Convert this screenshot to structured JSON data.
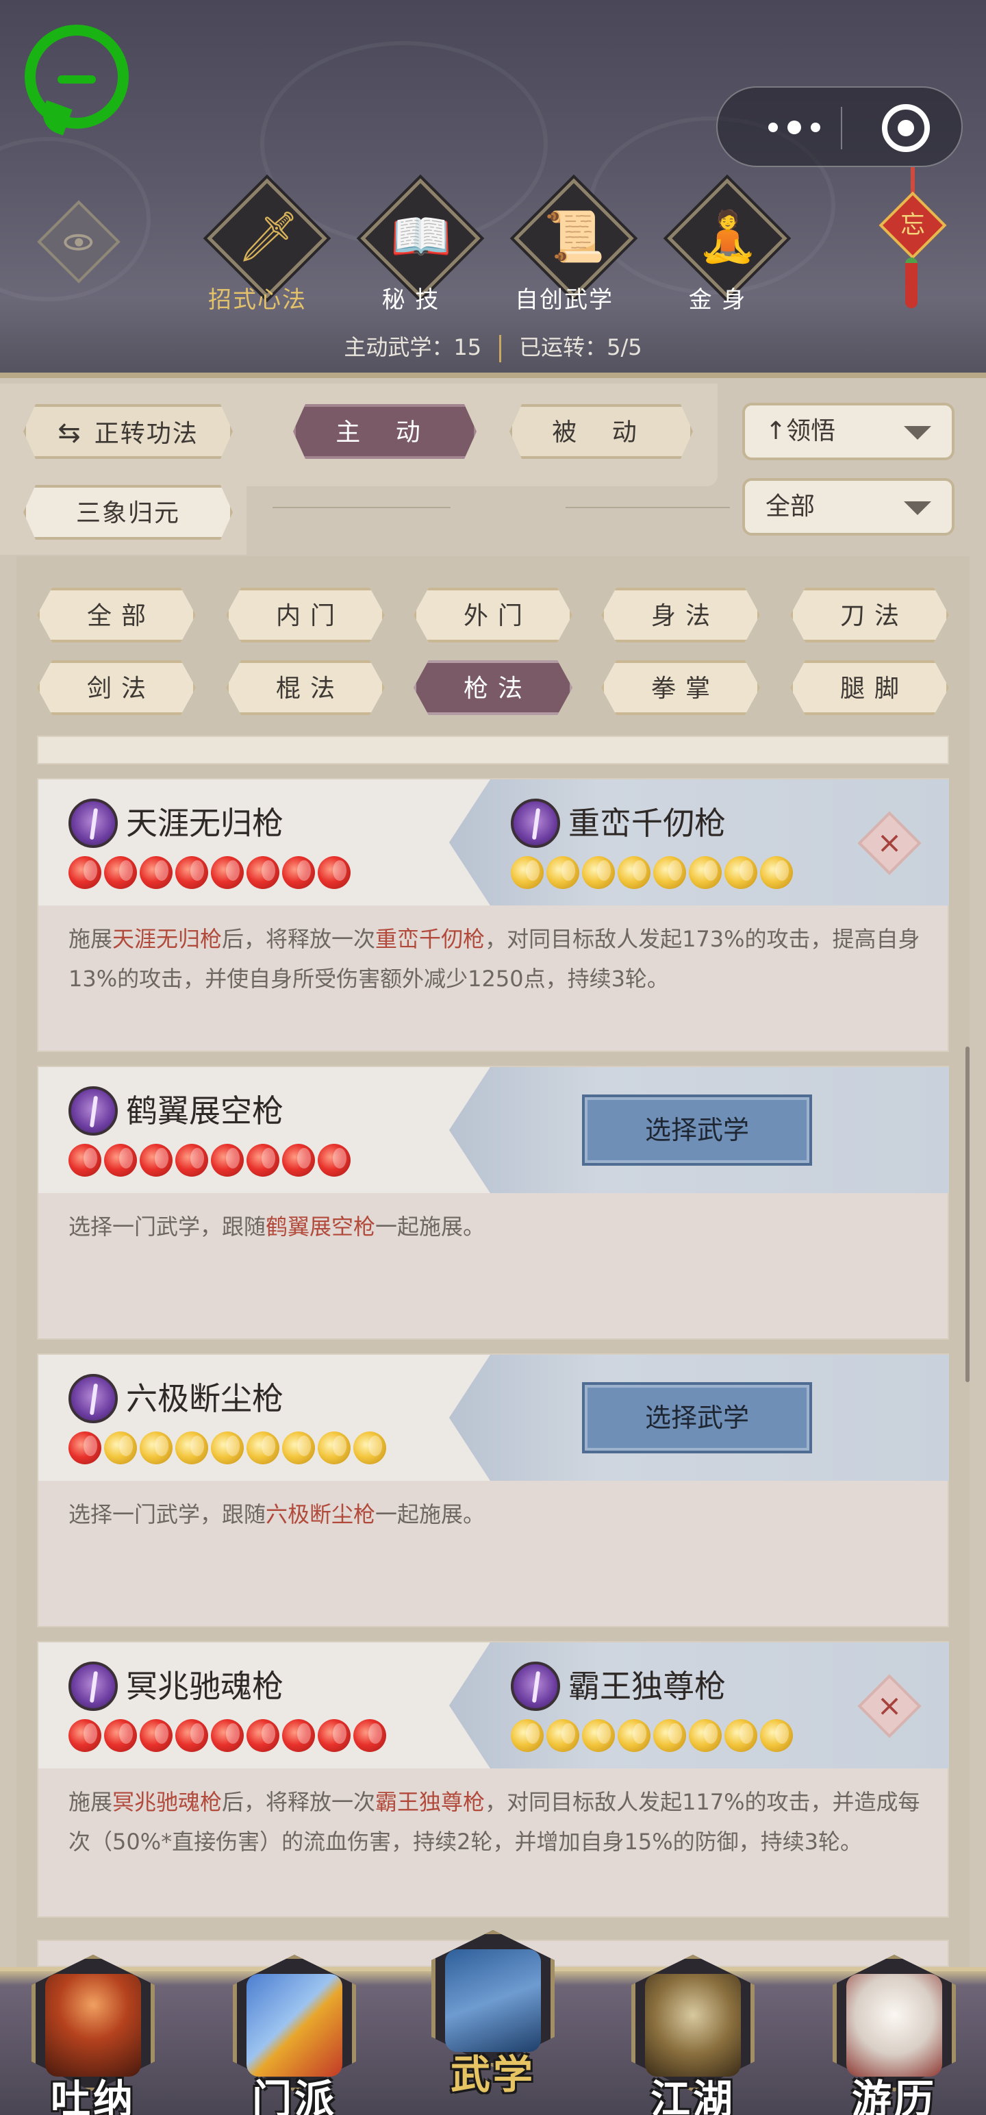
{
  "top_tabs": [
    {
      "label": "招式心法",
      "glyph": "🗡",
      "active": true
    },
    {
      "label": "秘 技",
      "glyph": "📖",
      "active": false
    },
    {
      "label": "自创武学",
      "glyph": "📜",
      "active": false
    },
    {
      "label": "金 身",
      "glyph": "🧘",
      "active": false
    }
  ],
  "stats": {
    "active_label": "主动武学：15",
    "running_label": "已运转：5/5"
  },
  "knot_char": "忘",
  "filters": {
    "switch_label": "正转功法",
    "switch_icon": "⇆",
    "active_btn": "主 动",
    "passive_btn": "被 动",
    "sanxiang": "三象归元",
    "sort_dropdown": "领悟",
    "sort_icon": "↑",
    "scope_dropdown": "全部"
  },
  "categories": [
    [
      "全部",
      "内门",
      "外门",
      "身法",
      "刀法"
    ],
    [
      "剑法",
      "棍法",
      "枪法",
      "拳掌",
      "腿脚"
    ]
  ],
  "active_category": "枪法",
  "cards": [
    {
      "left_name": "天涯无归枪",
      "left_pips": [
        "red",
        "red",
        "red",
        "red",
        "red",
        "red",
        "red",
        "red"
      ],
      "right_name": "重峦千仞枪",
      "right_pips": [
        "gold",
        "gold",
        "gold",
        "gold",
        "gold",
        "gold",
        "gold",
        "gold"
      ],
      "close": "×",
      "desc": [
        {
          "t": "施展"
        },
        {
          "t": "天涯无归枪",
          "hl": true
        },
        {
          "t": "后，将释放一次"
        },
        {
          "t": "重峦千仞枪",
          "hl": true
        },
        {
          "t": "，对同目标敌人发起173%的攻击，提高自身13%的攻击，并使自身所受伤害额外减少1250点，持续3轮。"
        }
      ]
    },
    {
      "left_name": "鹤翼展空枪",
      "left_pips": [
        "red",
        "red",
        "red",
        "red",
        "red",
        "red",
        "red",
        "red"
      ],
      "select_label": "选择武学",
      "desc": [
        {
          "t": "选择一门武学，跟随"
        },
        {
          "t": "鹤翼展空枪",
          "hl": true
        },
        {
          "t": "一起施展。"
        }
      ]
    },
    {
      "left_name": "六极断尘枪",
      "left_pips": [
        "red",
        "gold",
        "gold",
        "gold",
        "gold",
        "gold",
        "gold",
        "gold",
        "gold"
      ],
      "select_label": "选择武学",
      "desc": [
        {
          "t": "选择一门武学，跟随"
        },
        {
          "t": "六极断尘枪",
          "hl": true
        },
        {
          "t": "一起施展。"
        }
      ]
    },
    {
      "left_name": "冥兆驰魂枪",
      "left_pips": [
        "red",
        "red",
        "red",
        "red",
        "red",
        "red",
        "red",
        "red",
        "red"
      ],
      "right_name": "霸王独尊枪",
      "right_pips": [
        "gold",
        "gold",
        "gold",
        "gold",
        "gold",
        "gold",
        "gold",
        "gold"
      ],
      "close": "×",
      "desc": [
        {
          "t": "施展"
        },
        {
          "t": "冥兆驰魂枪",
          "hl": true
        },
        {
          "t": "后，将释放一次"
        },
        {
          "t": "霸王独尊枪",
          "hl": true
        },
        {
          "t": "，对同目标敌人发起117%的攻击，并造成每次（50%*直接伤害）的流血伤害，持续2轮，并增加自身15%的防御，持续3轮。"
        }
      ]
    }
  ],
  "bottom_nav": [
    {
      "label": "吐纳",
      "active": false,
      "art": "monk"
    },
    {
      "label": "门派",
      "active": false,
      "art": "flags"
    },
    {
      "label": "武学",
      "active": true,
      "art": "books"
    },
    {
      "label": "江湖",
      "active": false,
      "art": "hat"
    },
    {
      "label": "游历",
      "active": false,
      "art": "horse"
    }
  ],
  "colors": {
    "accent_active": "#7a5a66",
    "highlight_text": "#b24a3b",
    "gold_text": "#e3c26a",
    "select_button": "#6f8fb6"
  }
}
